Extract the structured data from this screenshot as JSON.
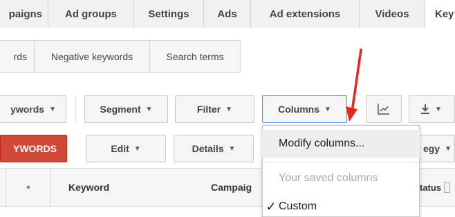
{
  "top_tabs": [
    {
      "label": "paigns"
    },
    {
      "label": "Ad groups"
    },
    {
      "label": "Settings"
    },
    {
      "label": "Ads"
    },
    {
      "label": "Ad extensions"
    },
    {
      "label": "Videos"
    },
    {
      "label": "Key"
    }
  ],
  "sub_tabs": [
    {
      "label": "rds"
    },
    {
      "label": "Negative keywords"
    },
    {
      "label": "Search terms"
    }
  ],
  "toolbar": {
    "keywords_view": "ywords",
    "segment": "Segment",
    "filter": "Filter",
    "columns": "Columns",
    "download_caret": "▾"
  },
  "row2": {
    "add_keywords": "YWORDS",
    "edit": "Edit",
    "details": "Details",
    "bid_strategy": "egy"
  },
  "table_header": {
    "dot": "●",
    "keyword": "Keyword",
    "campaign": "Campaig",
    "status": "tatus"
  },
  "columns_menu": {
    "modify": "Modify columns...",
    "saved_heading": "Your saved columns",
    "custom": "Custom",
    "check": "✓"
  },
  "colors": {
    "accent_blue": "#4d90fe",
    "add_button_red": "#d14836",
    "annotation_arrow": "#e8251c"
  }
}
